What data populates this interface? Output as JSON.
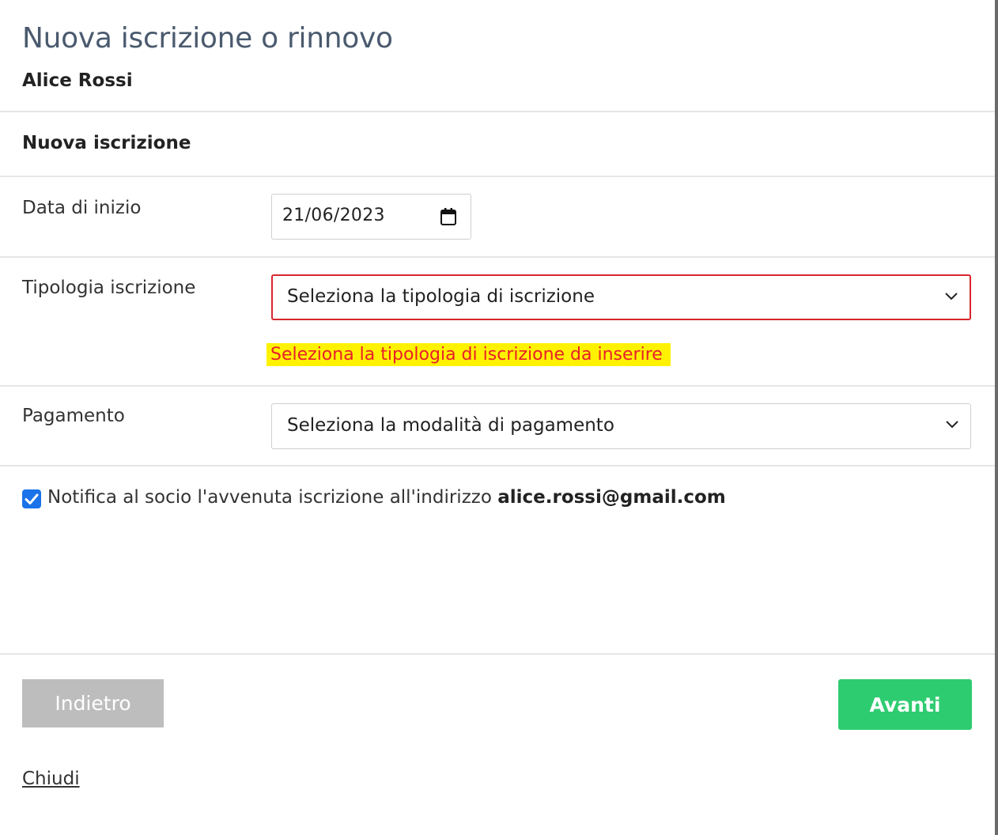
{
  "modal": {
    "title": "Nuova iscrizione o rinnovo",
    "subtitle": "Alice Rossi"
  },
  "section": {
    "title": "Nuova iscrizione"
  },
  "fields": {
    "start_date": {
      "label": "Data di inizio",
      "value": "21/06/2023"
    },
    "type": {
      "label": "Tipologia iscrizione",
      "selected": "Seleziona la tipologia di iscrizione",
      "error": "Seleziona la tipologia di iscrizione da inserire"
    },
    "payment": {
      "label": "Pagamento",
      "selected": "Seleziona la modalità di pagamento"
    }
  },
  "notify": {
    "checked": true,
    "text": "Notifica al socio l'avvenuta iscrizione all'indirizzo ",
    "email": "alice.rossi@gmail.com"
  },
  "buttons": {
    "back": "Indietro",
    "next": "Avanti",
    "close": "Chiudi"
  },
  "colors": {
    "title": "#4a5a6e",
    "error_border": "#d9262c",
    "error_text": "#e8202a",
    "error_highlight": "#fff200",
    "primary_button": "#2ecc71",
    "disabled_button": "#bdbdbd",
    "checkbox": "#1a73e8"
  }
}
